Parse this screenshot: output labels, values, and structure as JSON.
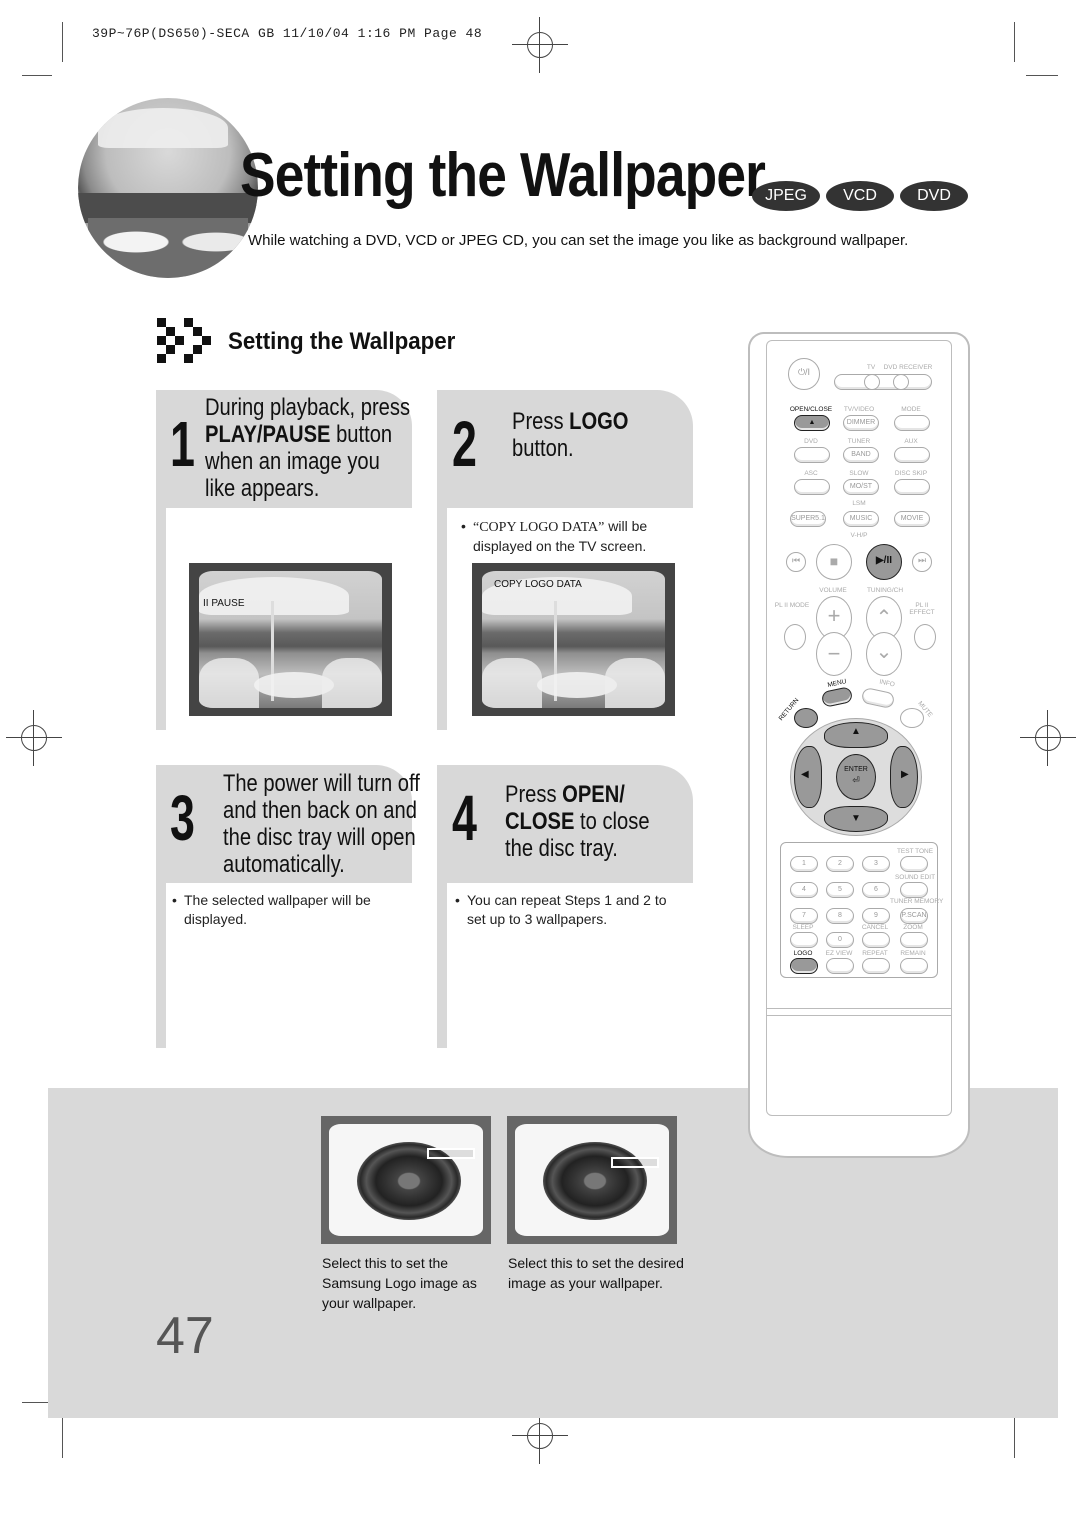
{
  "print_header": {
    "meta_text": "39P~76P(DS650)-SECA GB  11/10/04 1:16 PM  Page 48"
  },
  "page": {
    "title": "Setting the Wallpaper",
    "badges": [
      "JPEG",
      "VCD",
      "DVD"
    ],
    "intro": "While watching a DVD, VCD or JPEG CD, you can set the image you like as background wallpaper.",
    "section_title": "Setting the Wallpaper",
    "page_number": "47"
  },
  "steps": [
    {
      "number": "1",
      "lines": [
        "During playback, press",
        "PLAY/PAUSE button",
        "when an image you",
        "like appears."
      ],
      "bold_words": [
        "PLAY/PAUSE"
      ],
      "bullet": "",
      "screen_osd": "II PAUSE"
    },
    {
      "number": "2",
      "line1_prefix": "Press ",
      "line1_bold": "LOGO",
      "line2": "button.",
      "bullet_quote": "“COPY LOGO DATA”",
      "bullet_rest": " will be",
      "bullet_line2": "displayed on the TV screen.",
      "screen_osd": "COPY LOGO DATA"
    },
    {
      "number": "3",
      "lines": [
        "The power will turn off",
        "and then back on and",
        "the disc tray will open",
        "automatically."
      ],
      "bullet_line1": "The selected wallpaper will be",
      "bullet_line2": "displayed."
    },
    {
      "number": "4",
      "line1_prefix": "Press ",
      "line1_bold": "OPEN/",
      "line2_bold": "CLOSE",
      "line2_rest": " to close",
      "line3": "the disc tray.",
      "bullet_line1": "You can repeat Steps 1 and 2 to",
      "bullet_line2": "set up to 3 wallpapers."
    }
  ],
  "wallpaper_options": [
    {
      "caption_lines": [
        "Select this to set the",
        "Samsung Logo image as",
        "your wallpaper."
      ]
    },
    {
      "caption_lines": [
        "Select this to set the desired",
        "image as your wallpaper."
      ]
    }
  ],
  "remote": {
    "power_symbol": "⏻/I",
    "tv_label": "TV",
    "dvd_receiver_label": "DVD RECEIVER",
    "open_close_label": "OPEN/CLOSE",
    "eject_symbol": "▲",
    "tv_video_label": "TV/VIDEO",
    "dimmer_label": "DIMMER",
    "mode_label": "MODE",
    "dvd_label": "DVD",
    "tuner_label": "TUNER",
    "band_label": "BAND",
    "aux_label": "AUX",
    "asc_label": "ASC",
    "slow_label": "SLOW",
    "most_label": "MO/ST",
    "disc_skip_label": "DISC SKIP",
    "lsm_label": "LSM",
    "supers_label": "SUPER5.1",
    "music_label": "MUSIC",
    "movie_label": "MOVIE",
    "vhip_label": "V-H/P",
    "prev_symbol": "⏮",
    "stop_symbol": "■",
    "play_pause_symbol": "▶/II",
    "next_symbol": "⏭",
    "volume_label": "VOLUME",
    "tuning_label": "TUNING/CH",
    "pl2_mode_label": "PL II MODE",
    "pl2_effect_label": "PL II EFFECT",
    "plus_symbol": "+",
    "minus_symbol": "−",
    "up_symbol": "⌃",
    "down_symbol": "⌄",
    "menu_label": "MENU",
    "info_label": "INFO",
    "return_label": "RETURN",
    "mute_label": "MUTE",
    "enter_label": "ENTER",
    "numpad": [
      "1",
      "2",
      "3",
      "4",
      "5",
      "6",
      "7",
      "8",
      "9",
      "0"
    ],
    "test_tone_label": "TEST TONE",
    "sound_edit_label": "SOUND EDIT",
    "tuner_memory_label": "TUNER MEMORY",
    "pscan_label": "P.SCAN",
    "sleep_label": "SLEEP",
    "cancel_label": "CANCEL",
    "zoom_label": "ZOOM",
    "logo_label": "LOGO",
    "ez_view_label": "EZ VIEW",
    "repeat_label": "REPEAT",
    "remain_label": "REMAIN"
  },
  "colors": {
    "step_panel": "#d8d8d8",
    "bottom_panel": "#d9d9d9",
    "badge_bg": "#333333",
    "highlight_button": "#999999"
  }
}
